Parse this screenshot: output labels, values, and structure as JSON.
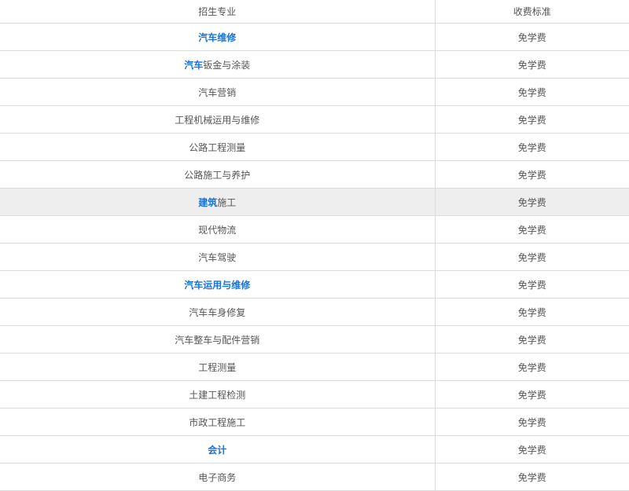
{
  "table": {
    "headers": {
      "major": "招生专业",
      "fee": "收费标准"
    },
    "rows": [
      {
        "link": "汽车维修",
        "rest": "",
        "fee": "免学费"
      },
      {
        "link": "汽车",
        "rest": "钣金与涂装",
        "fee": "免学费"
      },
      {
        "link": "",
        "rest": "汽车营销",
        "fee": "免学费"
      },
      {
        "link": "",
        "rest": "工程机械运用与维修",
        "fee": "免学费"
      },
      {
        "link": "",
        "rest": "公路工程测量",
        "fee": "免学费"
      },
      {
        "link": "",
        "rest": "公路施工与养护",
        "fee": "免学费"
      },
      {
        "link": "建筑",
        "rest": "施工",
        "fee": "免学费"
      },
      {
        "link": "",
        "rest": "现代物流",
        "fee": "免学费"
      },
      {
        "link": "",
        "rest": "汽车驾驶",
        "fee": "免学费"
      },
      {
        "link": "汽车运用与维修",
        "rest": "",
        "fee": "免学费"
      },
      {
        "link": "",
        "rest": "汽车车身修复",
        "fee": "免学费"
      },
      {
        "link": "",
        "rest": "汽车整车与配件营销",
        "fee": "免学费"
      },
      {
        "link": "",
        "rest": "工程测量",
        "fee": "免学费"
      },
      {
        "link": "",
        "rest": "土建工程检测",
        "fee": "免学费"
      },
      {
        "link": "",
        "rest": "市政工程施工",
        "fee": "免学费"
      },
      {
        "link": "会计",
        "rest": "",
        "fee": "免学费"
      },
      {
        "link": "",
        "rest": "电子商务",
        "fee": "免学费"
      }
    ]
  },
  "colors": {
    "link": "#1a73d9",
    "hover_row": "#eeeeee",
    "border": "#dcdcdc",
    "text": "#555555"
  }
}
